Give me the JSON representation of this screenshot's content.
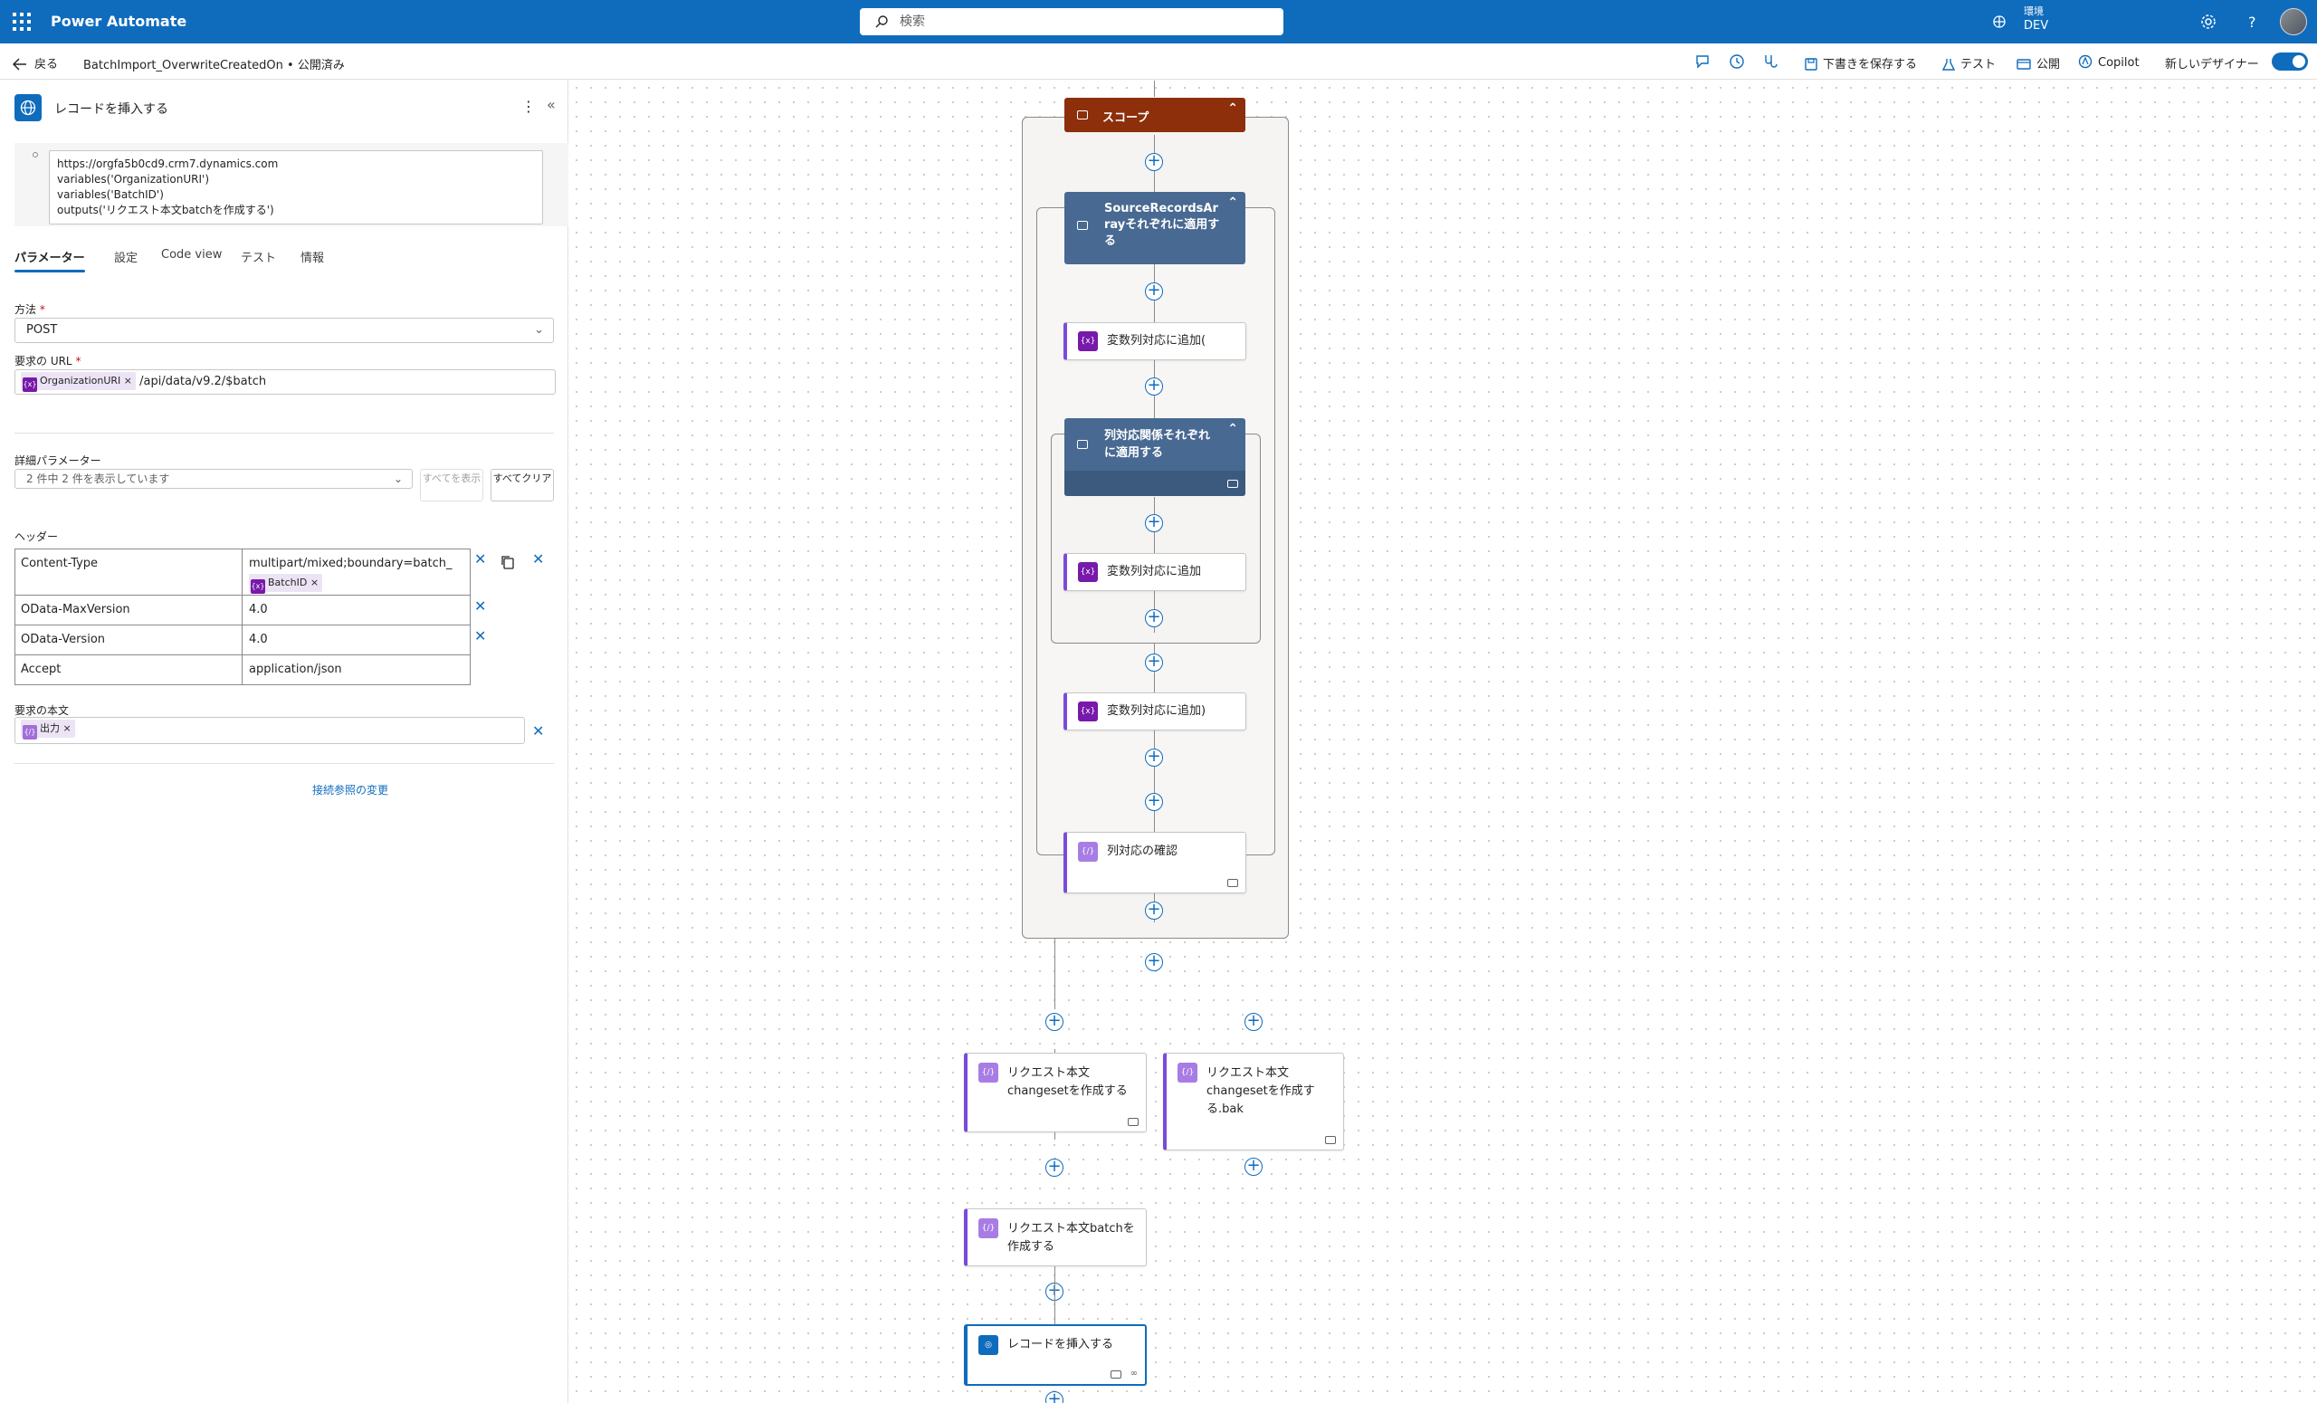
{
  "app": {
    "title": "Power Automate",
    "search_placeholder": "検索",
    "env_label": "環境",
    "env_name": "DEV"
  },
  "cmdbar": {
    "back": "戻る",
    "flow_name": "BatchImport_OverwriteCreatedOn • 公開済み",
    "save_draft": "下書きを保存する",
    "test": "テスト",
    "publish": "公開",
    "copilot": "Copilot",
    "new_designer": "新しいデザイナー",
    "new_designer_on": true
  },
  "panel": {
    "title": "レコードを挿入する",
    "notes": [
      "https://orgfa5b0cd9.crm7.dynamics.com",
      "variables('OrganizationURI')",
      "variables('BatchID')",
      "outputs('リクエスト本文batchを作成する')"
    ],
    "tabs": [
      "パラメーター",
      "設定",
      "Code view",
      "テスト",
      "情報"
    ],
    "active_tab": "パラメーター",
    "method_label": "方法",
    "method_value": "POST",
    "url_label": "要求の URL",
    "url_token": "OrganizationURI",
    "url_suffix": "/api/data/v9.2/$batch",
    "advanced_label": "詳細パラメーター",
    "advanced_value": "2 件中 2 件を表示しています",
    "show_all": "すべてを表示",
    "clear_all": "すべてクリア",
    "headers_label": "ヘッダー",
    "headers": [
      {
        "key": "Content-Type",
        "value": "multipart/mixed;boundary=batch_",
        "token": "BatchID"
      },
      {
        "key": "OData-MaxVersion",
        "value": "4.0"
      },
      {
        "key": "OData-Version",
        "value": "4.0"
      },
      {
        "key": "Accept",
        "value": "application/json"
      }
    ],
    "body_label": "要求の本文",
    "body_token": "出力",
    "change_ref": "接続参照の変更"
  },
  "flow": {
    "scope": "スコープ",
    "foreach1": "SourceRecordsArrayそれぞれに適用する",
    "append1": "変数列対応に追加(",
    "foreach2": "列対応関係それぞれに適用する",
    "append2": "変数列対応に追加",
    "append3": "変数列対応に追加)",
    "compose_check": "列対応の確認",
    "changeset": "リクエスト本文changesetを作成する",
    "changeset_bak": "リクエスト本文changesetを作成する.bak",
    "batch": "リクエスト本文batchを作成する",
    "insert": "レコードを挿入する"
  },
  "colors": {
    "brand": "#0f6cbd",
    "scope": "#8c2f0a",
    "foreach": "#486991",
    "variable": "#7719aa"
  }
}
